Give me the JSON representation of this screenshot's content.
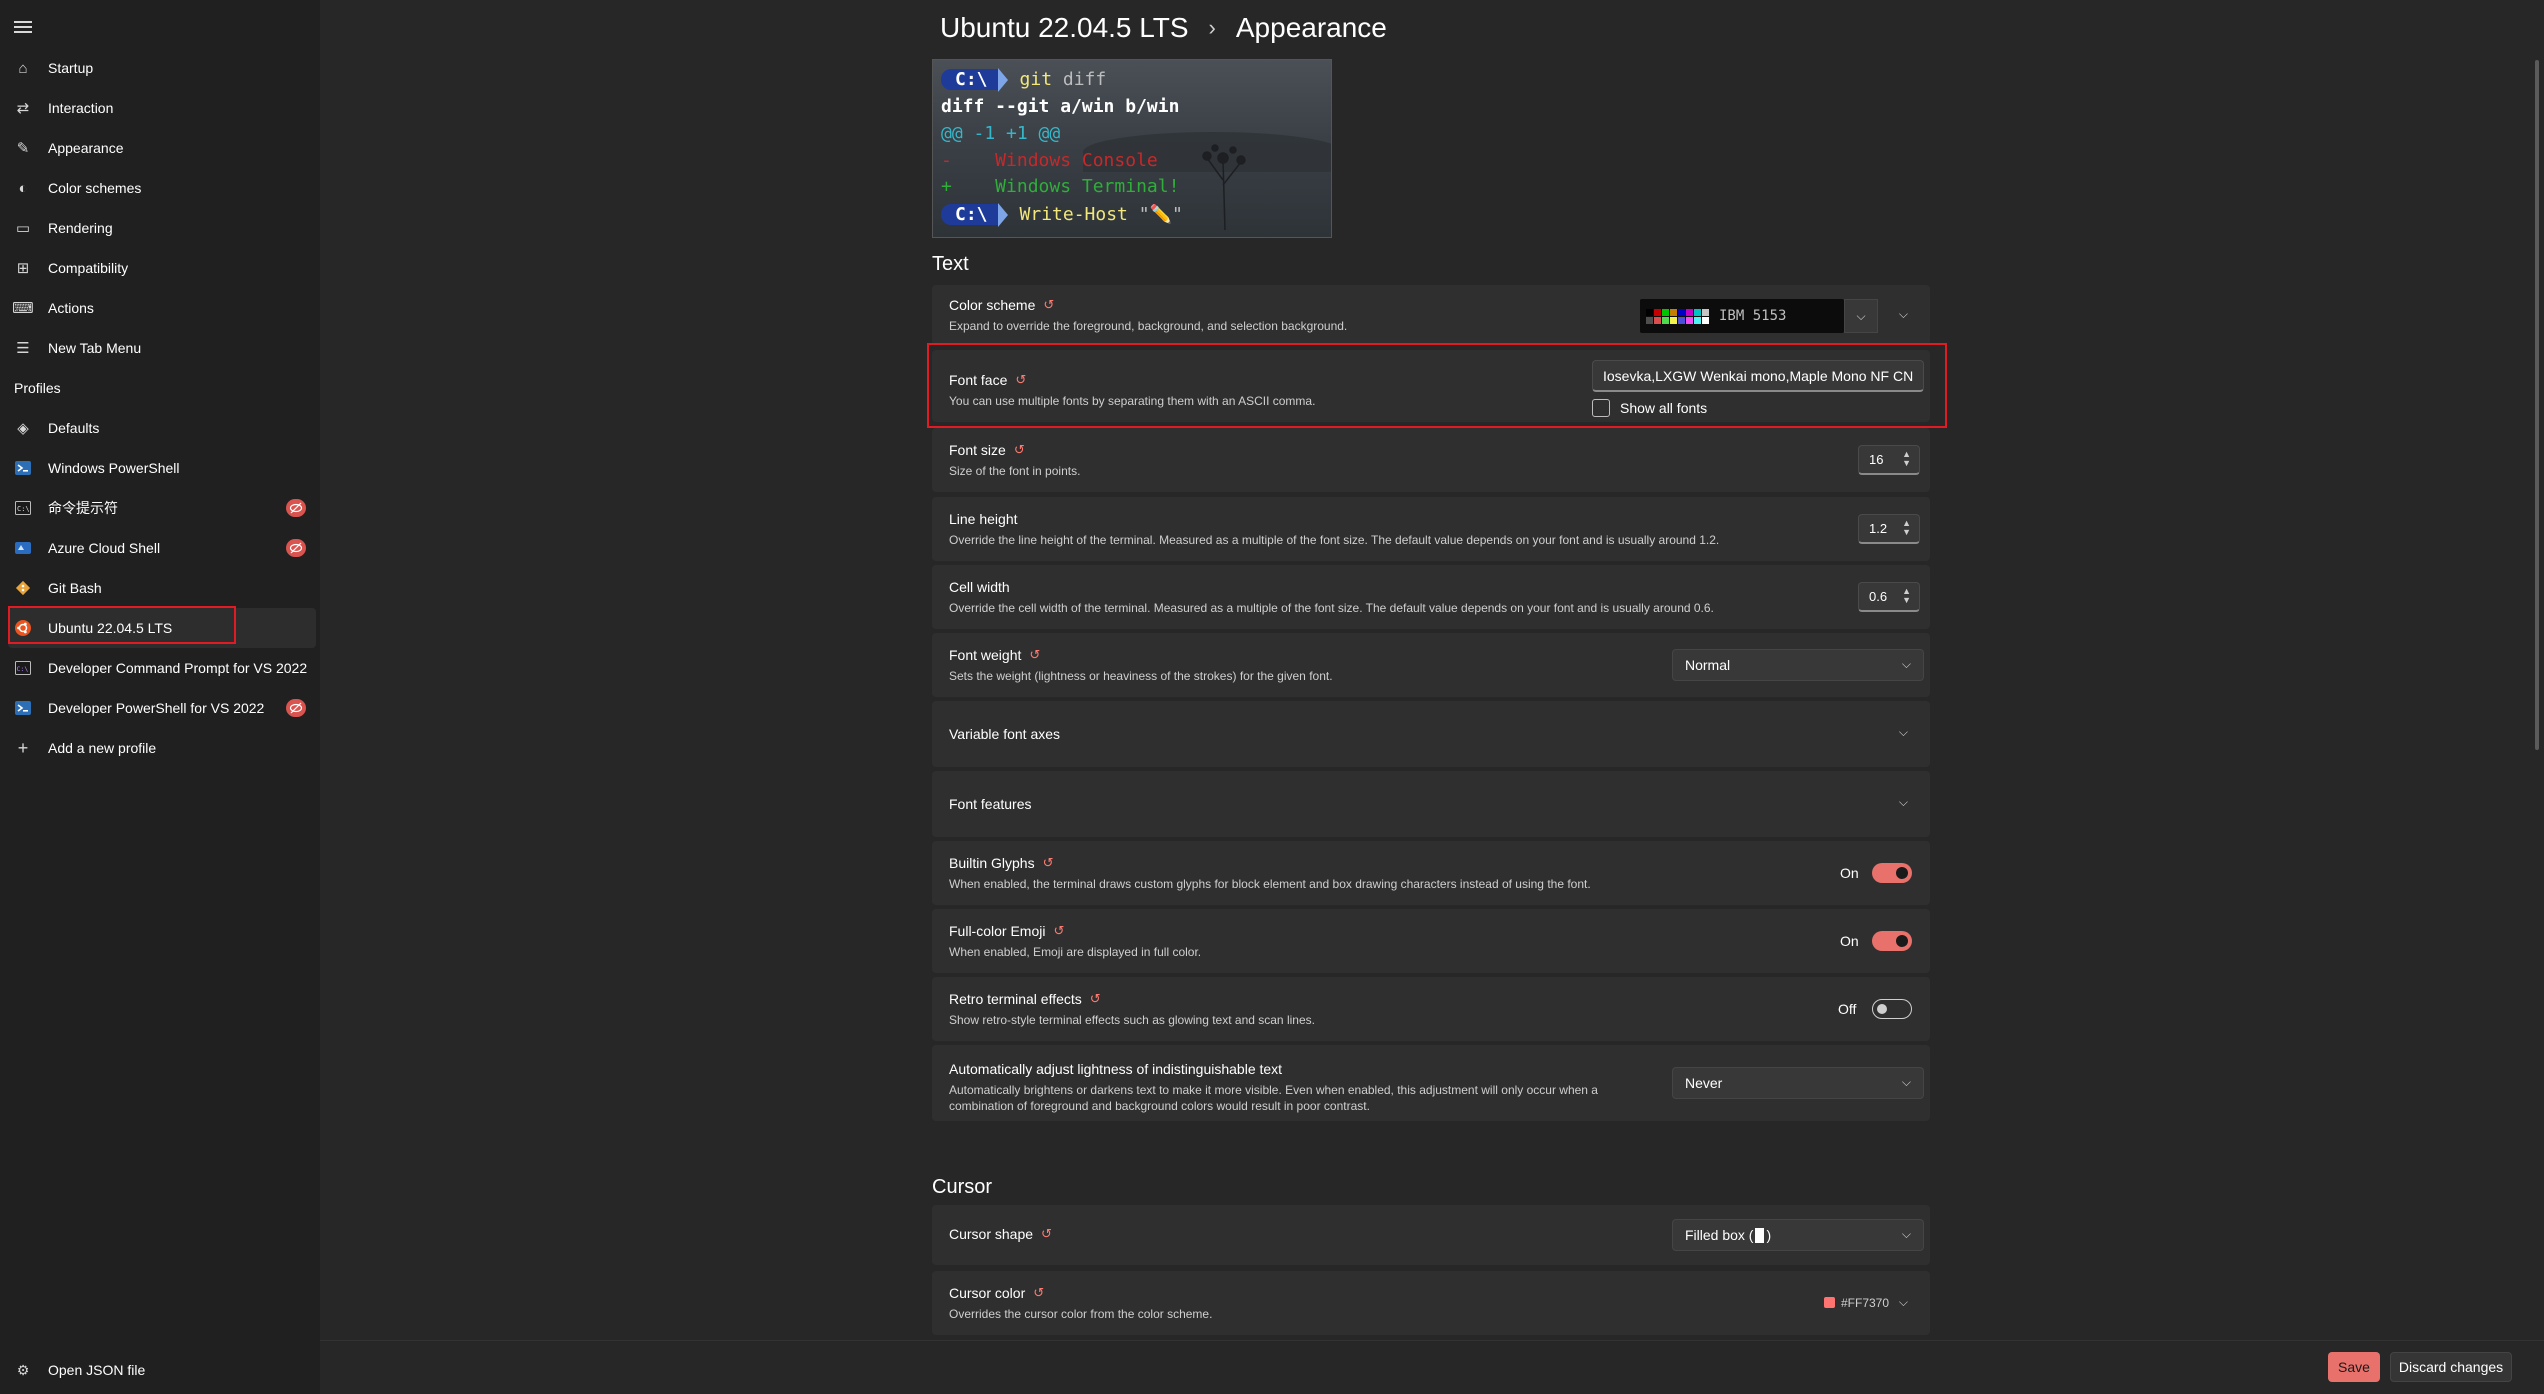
{
  "sidebar": {
    "items": [
      {
        "label": "Startup",
        "icon": "rocket-icon"
      },
      {
        "label": "Interaction",
        "icon": "interaction-icon"
      },
      {
        "label": "Appearance",
        "icon": "pen-icon"
      },
      {
        "label": "Color schemes",
        "icon": "palette-icon"
      },
      {
        "label": "Rendering",
        "icon": "monitor-icon"
      },
      {
        "label": "Compatibility",
        "icon": "compatibility-icon"
      },
      {
        "label": "Actions",
        "icon": "keyboard-icon"
      },
      {
        "label": "New Tab Menu",
        "icon": "list-icon"
      }
    ],
    "profiles_heading": "Profiles",
    "profiles": [
      {
        "label": "Defaults",
        "icon": "layers-icon",
        "hidden": false
      },
      {
        "label": "Windows PowerShell",
        "icon": "powershell-icon",
        "hidden": false
      },
      {
        "label": "命令提示符",
        "icon": "cmd-icon",
        "hidden": true
      },
      {
        "label": "Azure Cloud Shell",
        "icon": "azure-icon",
        "hidden": true
      },
      {
        "label": "Git Bash",
        "icon": "git-icon",
        "hidden": false
      },
      {
        "label": "Ubuntu 22.04.5 LTS",
        "icon": "ubuntu-icon",
        "hidden": false
      },
      {
        "label": "Developer Command Prompt for VS 2022",
        "icon": "vs-cmd-icon",
        "hidden": false
      },
      {
        "label": "Developer PowerShell for VS 2022",
        "icon": "vs-powershell-icon",
        "hidden": true
      },
      {
        "label": "Add a new profile",
        "icon": "plus-icon",
        "hidden": false
      }
    ],
    "open_json": "Open JSON file"
  },
  "header": {
    "profile": "Ubuntu 22.04.5 LTS",
    "page": "Appearance"
  },
  "preview": {
    "prompt": "C:\\",
    "line1_cmd": "git",
    "line1_arg": "diff",
    "line2": "diff --git a/win b/win",
    "line3": "@@ -1 +1 @@",
    "line4": "-    Windows Console",
    "line5": "+    Windows Terminal!",
    "line6_cmd": "Write-Host",
    "line6_arg": "\"✏️\""
  },
  "text_section": {
    "heading": "Text",
    "color_scheme": {
      "title": "Color scheme",
      "desc": "Expand to override the foreground, background, and selection background.",
      "value": "IBM 5153",
      "swatches": [
        "#000000",
        "#c40000",
        "#00c400",
        "#c47e00",
        "#0000c4",
        "#c400c4",
        "#00c4c4",
        "#c4c4c4",
        "#4e4e4e",
        "#dc4e4e",
        "#4edc4e",
        "#f3f34e",
        "#4e4edc",
        "#f34ef3",
        "#4ef3f3",
        "#ffffff"
      ]
    },
    "font_face": {
      "title": "Font face",
      "desc": "You can use multiple fonts by separating them with an ASCII comma.",
      "value": "Iosevka,LXGW Wenkai mono,Maple Mono NF CN",
      "show_all": "Show all fonts"
    },
    "font_size": {
      "title": "Font size",
      "desc": "Size of the font in points.",
      "value": "16"
    },
    "line_height": {
      "title": "Line height",
      "desc": "Override the line height of the terminal. Measured as a multiple of the font size. The default value depends on your font and is usually around 1.2.",
      "value": "1.2"
    },
    "cell_width": {
      "title": "Cell width",
      "desc": "Override the cell width of the terminal. Measured as a multiple of the font size. The default value depends on your font and is usually around 0.6.",
      "value": "0.6"
    },
    "font_weight": {
      "title": "Font weight",
      "desc": "Sets the weight (lightness or heaviness of the strokes) for the given font.",
      "value": "Normal"
    },
    "variable_axes": {
      "title": "Variable font axes"
    },
    "font_features": {
      "title": "Font features"
    },
    "builtin_glyphs": {
      "title": "Builtin Glyphs",
      "desc": "When enabled, the terminal draws custom glyphs for block element and box drawing characters instead of using the font.",
      "state": "On"
    },
    "full_color_emoji": {
      "title": "Full-color Emoji",
      "desc": "When enabled, Emoji are displayed in full color.",
      "state": "On"
    },
    "retro": {
      "title": "Retro terminal effects",
      "desc": "Show retro-style terminal effects such as glowing text and scan lines.",
      "state": "Off"
    },
    "auto_adjust": {
      "title": "Automatically adjust lightness of indistinguishable text",
      "desc1": "Automatically brightens or darkens text to make it more visible. Even when enabled, this adjustment will only occur when a",
      "desc2": "combination of foreground and background colors would result in poor contrast.",
      "value": "Never"
    }
  },
  "cursor_section": {
    "heading": "Cursor",
    "cursor_shape": {
      "title": "Cursor shape",
      "value_pre": "Filled box (",
      "value_post": ")"
    },
    "cursor_color": {
      "title": "Cursor color",
      "desc": "Overrides the cursor color from the color scheme.",
      "value": "#FF7370",
      "color": "#ff7370"
    }
  },
  "footer": {
    "save": "Save",
    "discard": "Discard changes"
  },
  "colors": {
    "accent": "#e8716b",
    "highlight": "#e01b24"
  }
}
